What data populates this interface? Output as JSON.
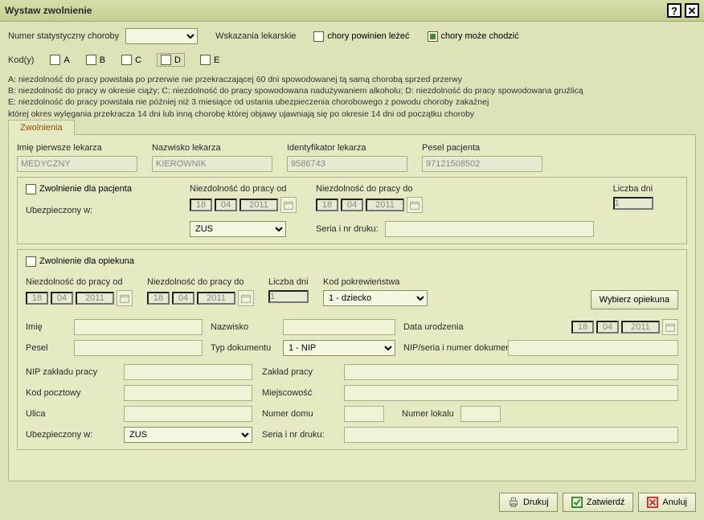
{
  "window": {
    "title": "Wystaw zwolnienie"
  },
  "top": {
    "stat_label": "Numer statystyczny choroby",
    "indications_label": "Wskazania lekarskie",
    "chk_lie": "chory powinien leżeć",
    "chk_walk": "chory może chodzić"
  },
  "codes": {
    "label": "Kod(y)",
    "a": "A",
    "b": "B",
    "c": "C",
    "d": "D",
    "e": "E",
    "notes": "A: niezdolność do pracy powstała po przerwie nie przekraczającej 60 dni spowodowanej tą samą chorobą sprzed przerwy\nB: niezdolność do pracy w okresie ciąży; C: niezdolność do pracy spowodowana nadużywaniem alkoholu; D: niezdolność do pracy spowodowana gruźlicą\nE: niezdolność do pracy powstała nie później niż 3 miesiące od ustania ubezpieczenia chorobowego z powodu choroby zakaźnej\n   której okres wylęgania przekracza 14 dni lub inną chorobę której objawy ujawniają się po okresie 14 dni od początku choroby"
  },
  "tab_label": "Zwolnienia",
  "doctor": {
    "first_label": "Imię pierwsze lekarza",
    "first": "MEDYCZNY",
    "last_label": "Nazwisko lekarza",
    "last": "KIEROWNIK",
    "id_label": "Identyfikator lekarza",
    "id": "9586743",
    "pesel_label": "Pesel pacjenta",
    "pesel": "97121508502"
  },
  "patient_leave": {
    "chk": "Zwolnienie dla pacjenta",
    "from_label": "Niezdolność do pracy od",
    "to_label": "Niezdolność do pracy do",
    "days_label": "Liczba dni",
    "from": {
      "d": "18",
      "m": "04",
      "y": "2011"
    },
    "to": {
      "d": "18",
      "m": "04",
      "y": "2011"
    },
    "days": "1",
    "insured_label": "Ubezpieczony w:",
    "insured": "ZUS",
    "print_label": "Seria i nr druku:"
  },
  "caretaker_leave": {
    "chk": "Zwolnienie dla opiekuna",
    "from_label": "Niezdolność do pracy od",
    "to_label": "Niezdolność do pracy do",
    "days_label": "Liczba dni",
    "rel_label": "Kod pokrewieństwa",
    "from": {
      "d": "18",
      "m": "04",
      "y": "2011"
    },
    "to": {
      "d": "18",
      "m": "04",
      "y": "2011"
    },
    "days": "1",
    "rel": "1 - dziecko",
    "choose_btn": "Wybierz opiekuna",
    "name_label": "Imię",
    "surname_label": "Nazwisko",
    "dob_label": "Data urodzenia",
    "dob": {
      "d": "18",
      "m": "04",
      "y": "2011"
    },
    "pesel_label": "Pesel",
    "doctype_label": "Typ dokumentu",
    "doctype": "1 - NIP",
    "docnum_label": "NIP/seria i numer dokumentu",
    "nip_label": "NIP zakładu pracy",
    "work_label": "Zakład pracy",
    "postal_label": "Kod pocztowy",
    "city_label": "Miejscowość",
    "street_label": "Ulica",
    "house_label": "Numer domu",
    "flat_label": "Numer lokalu",
    "insured_label": "Ubezpieczony w:",
    "insured": "ZUS",
    "print_label": "Seria i nr druku:"
  },
  "footer": {
    "print": "Drukuj",
    "confirm": "Zatwierdź",
    "cancel": "Anuluj"
  }
}
